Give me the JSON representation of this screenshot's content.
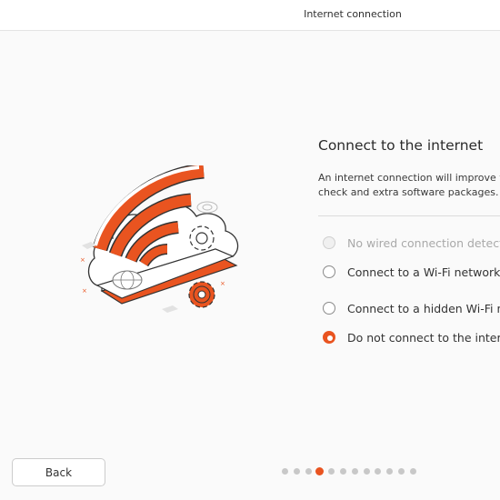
{
  "window": {
    "title": "Internet connection"
  },
  "page": {
    "heading": "Connect to the internet",
    "description_lines": [
      "An internet connection will improve y",
      "check and extra software packages."
    ]
  },
  "options": [
    {
      "label": "No wired connection detect",
      "disabled": true,
      "selected": false
    },
    {
      "label": "Connect to a Wi-Fi network",
      "disabled": false,
      "selected": false
    },
    {
      "label": "Connect to a hidden Wi-Fi ne",
      "disabled": false,
      "selected": false
    },
    {
      "label": "Do not connect to the intern",
      "disabled": false,
      "selected": true
    }
  ],
  "footer": {
    "back_label": "Back",
    "step_count": 12,
    "current_step": 4
  },
  "colors": {
    "accent": "#e95420",
    "illustration_outline": "#333333"
  },
  "illustration": {
    "icons": [
      "wifi-icon",
      "cloud-icon",
      "gear-icon",
      "globe-icon"
    ]
  }
}
